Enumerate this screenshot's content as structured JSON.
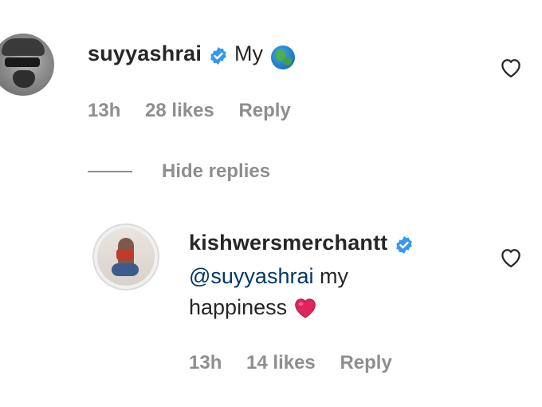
{
  "comments": [
    {
      "username": "suyyashrai",
      "verified": true,
      "text": "My",
      "emoji": "globe-emoji",
      "time": "13h",
      "likes": "28 likes",
      "reply_label": "Reply"
    }
  ],
  "hide_replies_label": "Hide replies",
  "replies": [
    {
      "username": "kishwersmerchantt",
      "verified": true,
      "mention": "@suyyashrai",
      "text_line1_rest": " my",
      "text_line2": "happiness",
      "emoji": "red-heart-emoji",
      "time": "13h",
      "likes": "14 likes",
      "reply_label": "Reply"
    }
  ],
  "colors": {
    "verified_blue": "#3897f0",
    "muted_text": "#8e8e8e",
    "mention_blue": "#00376b",
    "heart_red": "#e0245e"
  },
  "icons": [
    "verified-badge-icon",
    "heart-outline-icon",
    "globe-emoji",
    "red-heart-emoji"
  ]
}
